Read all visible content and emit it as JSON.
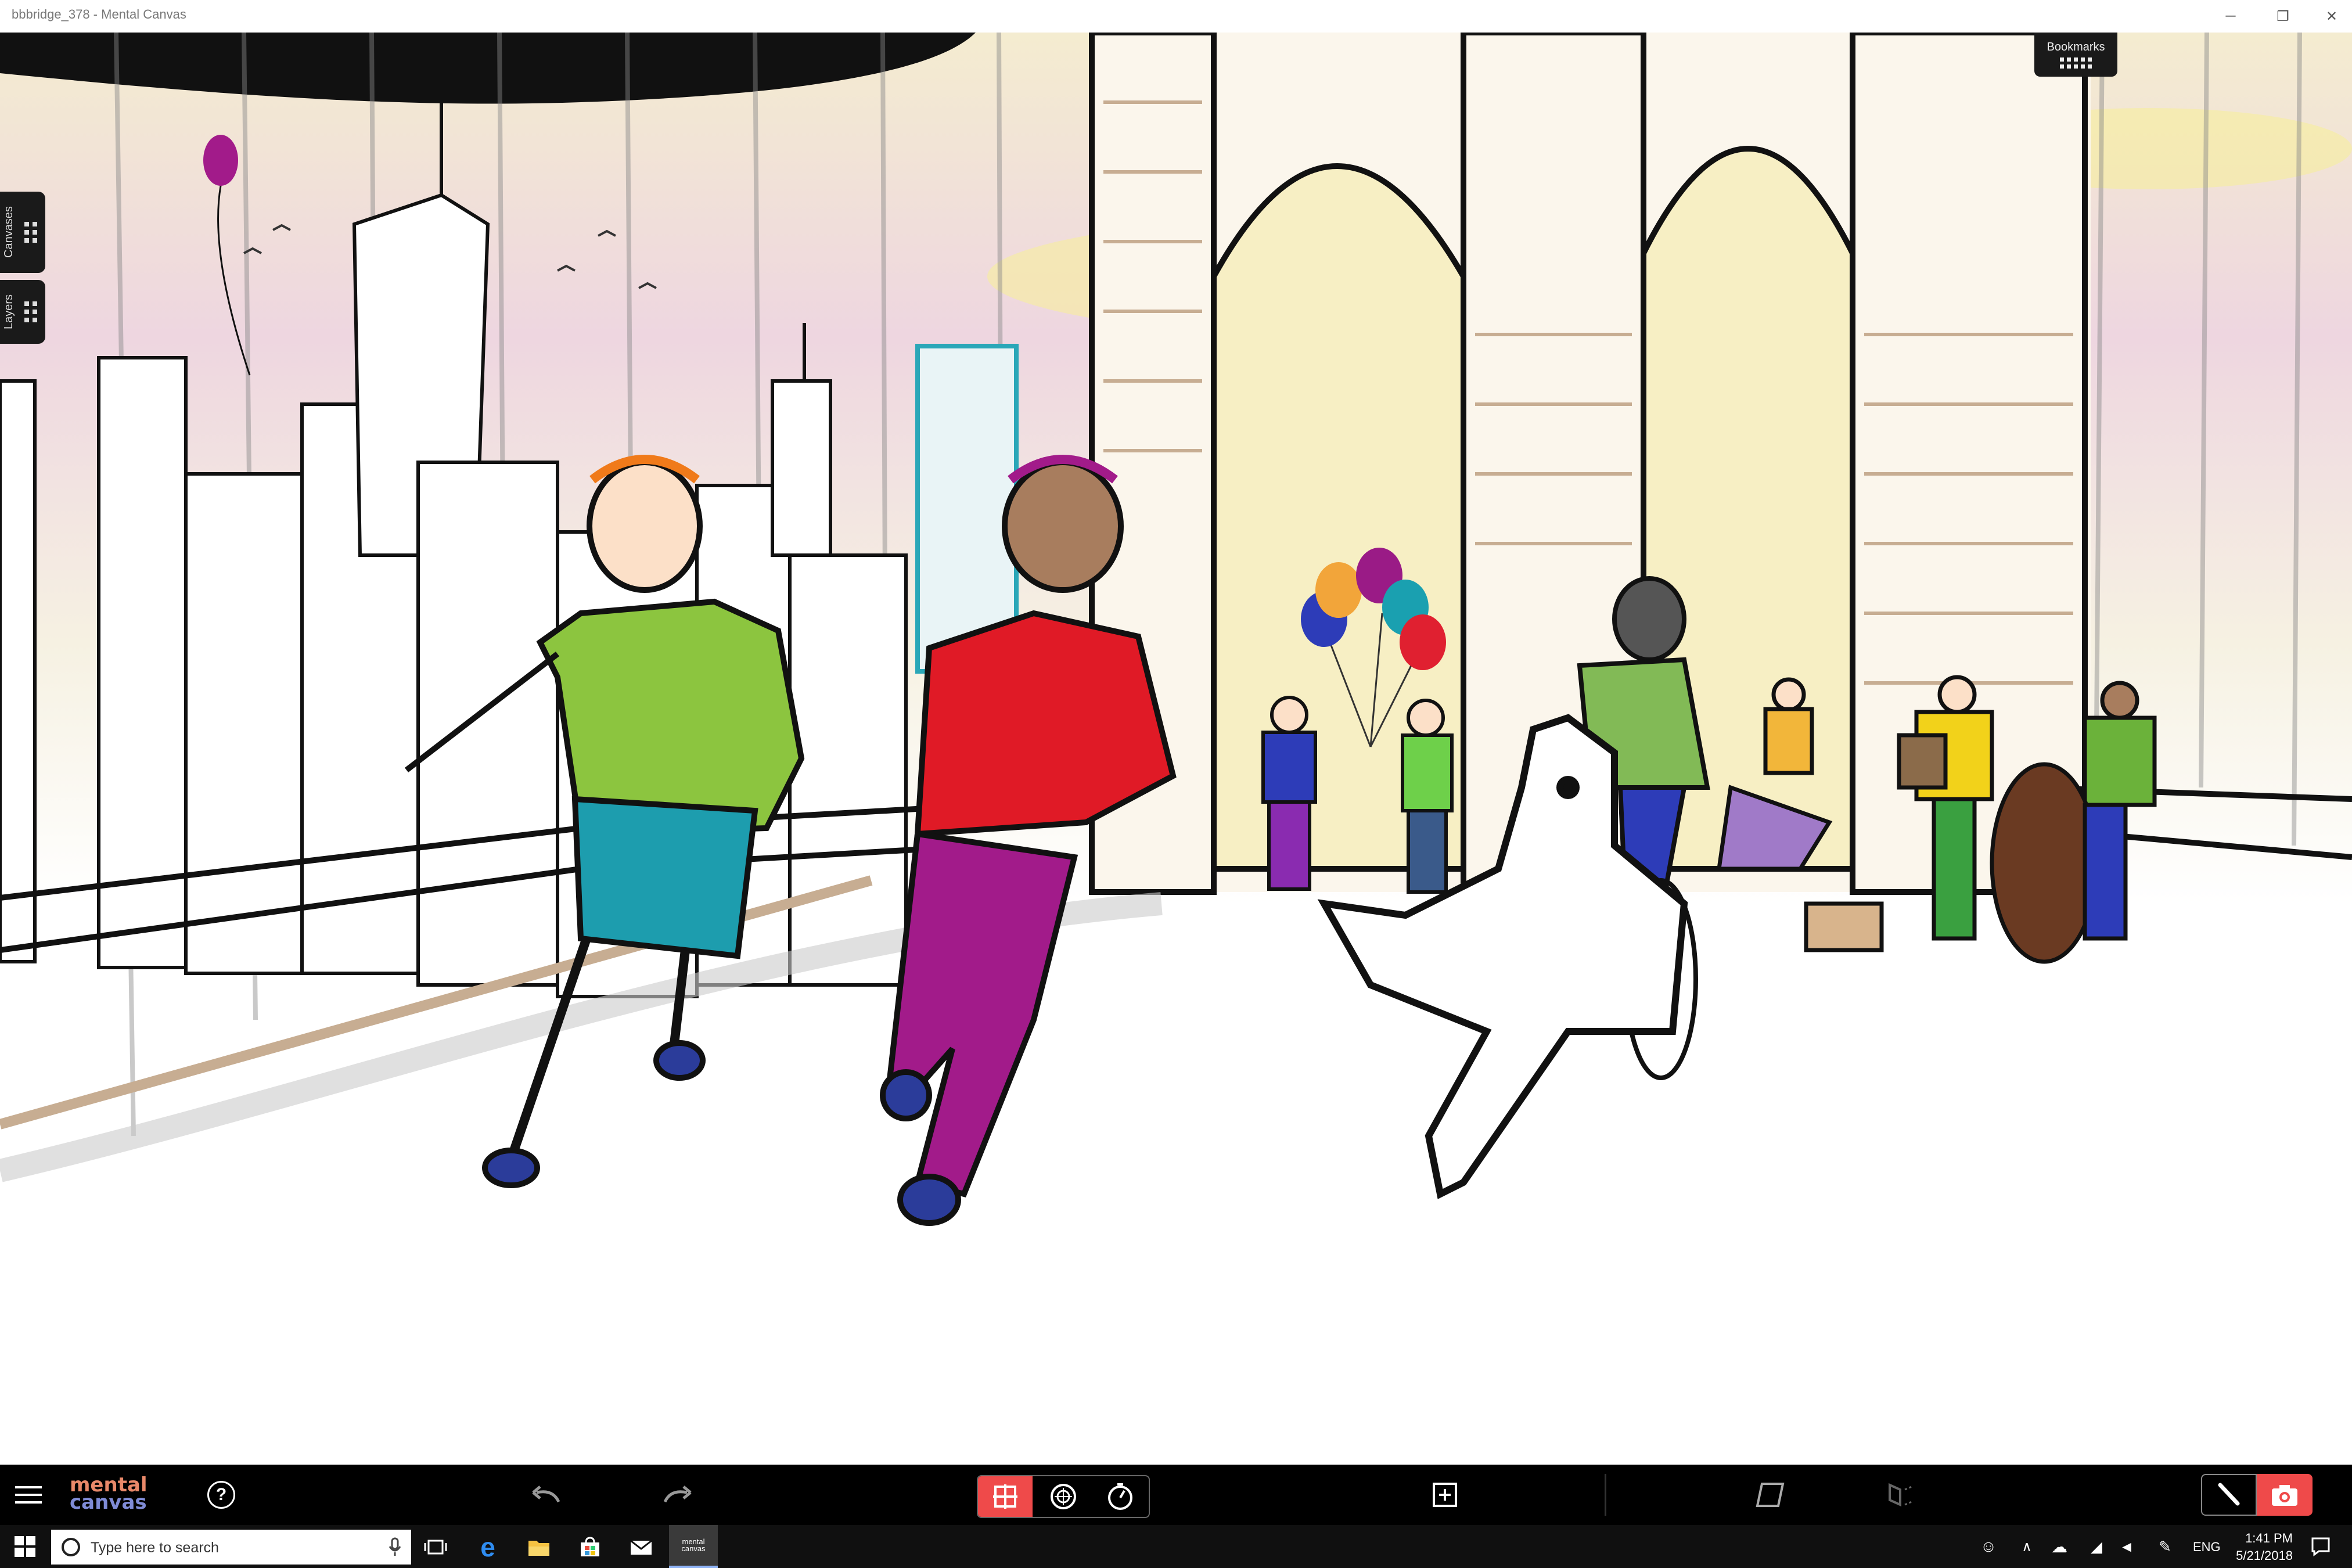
{
  "window": {
    "title": "bbbridge_378 - Mental Canvas",
    "minimize_icon": "minimize-icon",
    "restore_icon": "restore-icon",
    "close_icon": "close-icon"
  },
  "side_panels": {
    "canvases_label": "Canvases",
    "layers_label": "Layers"
  },
  "bookmarks": {
    "label": "Bookmarks"
  },
  "toolbar": {
    "logo_line1": "mental",
    "logo_line2": "canvas",
    "help_label": "?",
    "tools": [
      "move-tool-icon",
      "orbit-tool-icon",
      "dolly-tool-icon"
    ],
    "active_tool": "move-tool-icon"
  },
  "taskbar": {
    "search_placeholder": "Type here to search",
    "apps": [
      "task-view-icon",
      "edge-icon",
      "file-explorer-icon",
      "store-icon",
      "mail-icon",
      "mental-canvas-app-icon"
    ],
    "mental_canvas_app_label": "mental canvas",
    "language": "ENG",
    "time": "1:41 PM",
    "date": "5/21/2018"
  },
  "colors": {
    "accent": "#ef4a4a",
    "toolbar_bg": "#000000",
    "taskbar_bg": "#101010"
  }
}
